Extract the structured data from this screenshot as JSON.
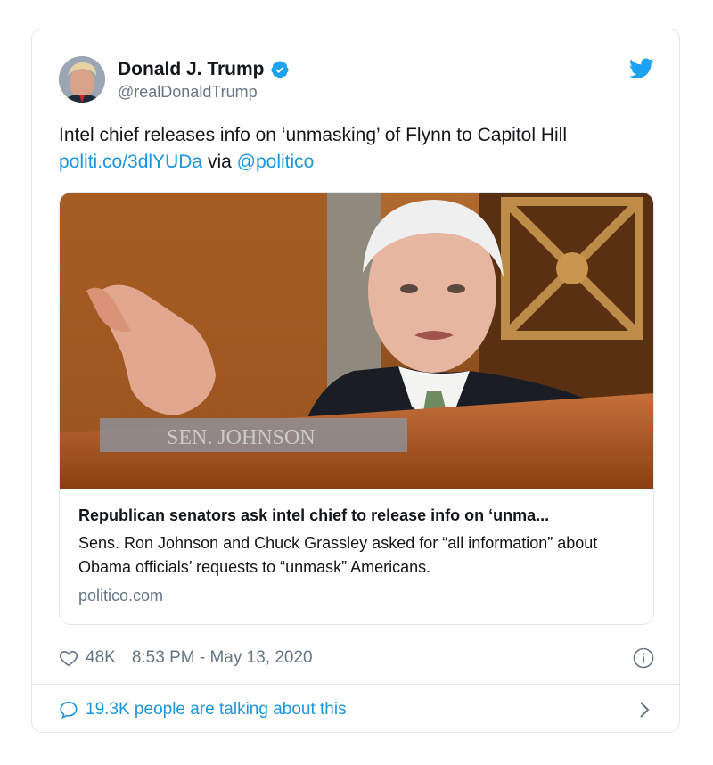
{
  "author": {
    "display_name": "Donald J. Trump",
    "handle": "@realDonaldTrump",
    "verified": true
  },
  "tweet": {
    "text": "Intel chief releases info on ‘unmasking’ of Flynn to Capitol Hill",
    "link": "politi.co/3dlYUDa",
    "via_word": "via",
    "mention": "@politico"
  },
  "card": {
    "title": "Republican senators ask intel chief to release info on ‘unma...",
    "description": "Sens. Ron Johnson and Chuck Grassley asked for “all information” about Obama officials’ requests to “unmask” Americans.",
    "domain": "politico.com",
    "image_nameplate": "SEN. JOHNSON"
  },
  "meta": {
    "likes": "48K",
    "timestamp": "8:53 PM - May 13, 2020"
  },
  "footer": {
    "talking": "19.3K people are talking about this"
  },
  "icons": {
    "twitter": "twitter-bird-icon",
    "verified": "verified-badge-icon",
    "like": "heart-icon",
    "info": "info-icon",
    "reply": "speech-bubble-icon",
    "chevron": "chevron-right-icon"
  },
  "colors": {
    "brand": "#1da1f2",
    "link": "#1b95e0",
    "muted": "#657786",
    "border": "#e1e8ed"
  }
}
